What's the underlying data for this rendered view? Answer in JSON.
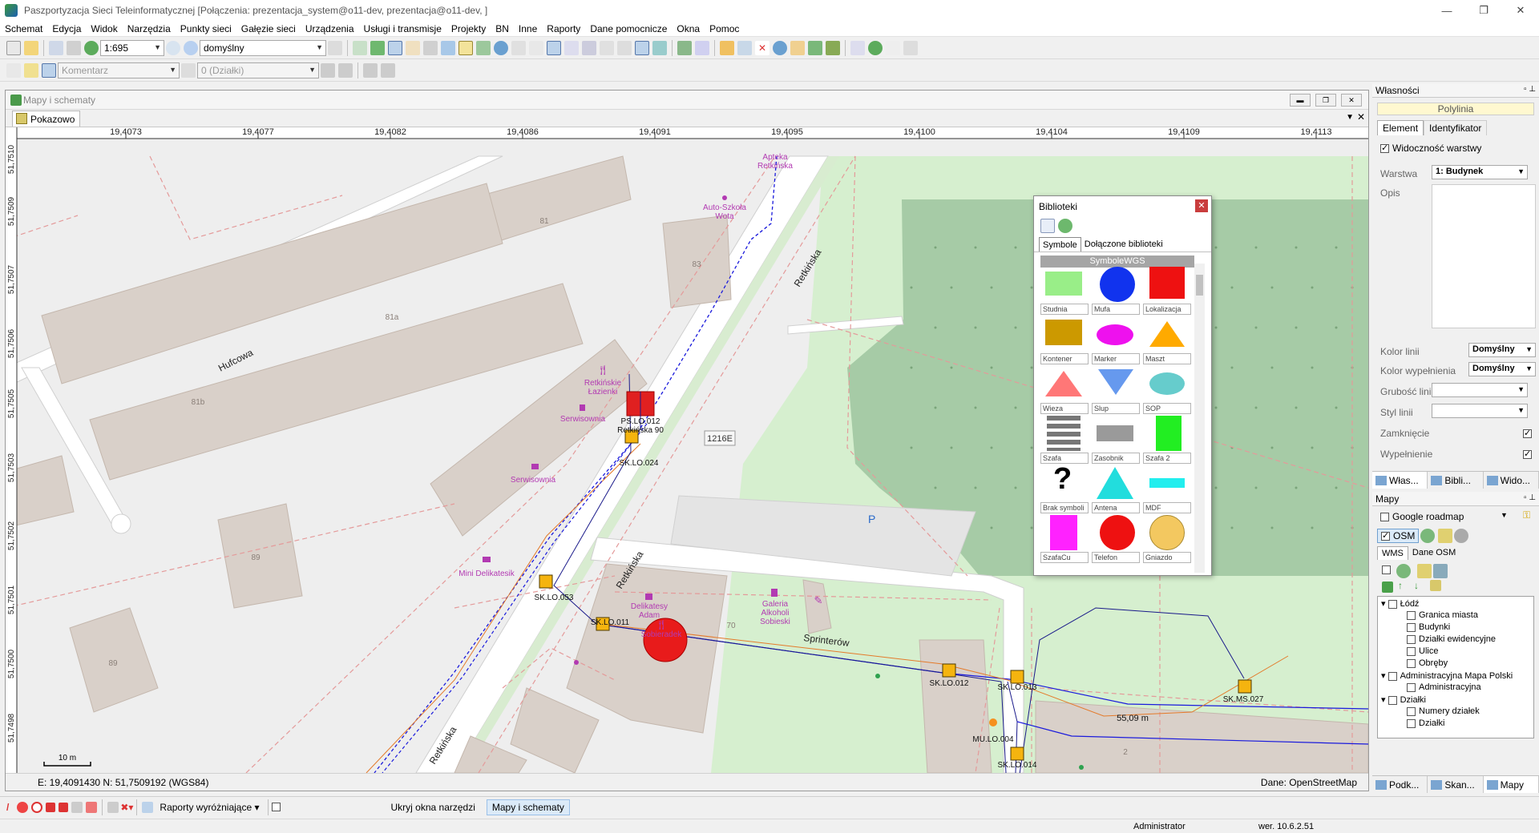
{
  "window": {
    "title": "Paszportyzacja Sieci Teleinformatycznej [Połączenia: prezentacja_system@o11-dev, prezentacja@o11-dev, ]"
  },
  "menu": [
    "Schemat",
    "Edycja",
    "Widok",
    "Narzędzia",
    "Punkty sieci",
    "Gałęzie sieci",
    "Urządzenia",
    "Usługi i transmisje",
    "Projekty",
    "BN",
    "Inne",
    "Raporty",
    "Dane pomocnicze",
    "Okna",
    "Pomoc"
  ],
  "toolbar1": {
    "scale": "1:695",
    "style": "domyślny"
  },
  "toolbar2": {
    "comment": "Komentarz",
    "parcels": "0 (Działki)"
  },
  "mapwindow": {
    "title": "Mapy i schematy",
    "tab": "Pokazowo",
    "status_coords": "E: 19,4091430  N: 51,7509192 (WGS84)",
    "status_source": "Dane: OpenStreetMap",
    "x_ticks": [
      "19,4073",
      "19,4077",
      "19,4082",
      "19,4086",
      "19,4091",
      "19,4095",
      "19,4100",
      "19,4104",
      "19,4109",
      "19,4113"
    ],
    "y_ticks": [
      "51,7510",
      "51,7509",
      "51,7507",
      "51,7506",
      "51,7505",
      "51,7503",
      "51,7502",
      "51,7501",
      "51,7500",
      "51,7498"
    ],
    "map_labels": {
      "street1": "Hufcowa",
      "street2": "Retkińska",
      "street3": "Retkińska",
      "street4": "Retkińska",
      "street5": "Sprinterów",
      "road_badge": "1216E",
      "b81": "81",
      "b81a": "81a",
      "b81b": "81b",
      "b83": "83",
      "b89a": "89",
      "b89b": "89",
      "b70": "70",
      "b2": "2",
      "poi1": "Apteka",
      "poi1b": "Retkińska",
      "poi2": "Auto-Szkoła",
      "poi2b": "Wota",
      "poi3": "Retkińskie",
      "poi3b": "Łazienki",
      "poi4": "Serwisownia",
      "poi5": "Serwisownia",
      "poi6": "Mini Delikatesik",
      "poi7": "Delikatesy",
      "poi7b": "Adam",
      "poi8": "Sobieradek",
      "poi9": "Galeria",
      "poi9b": "Alkoholi",
      "poi9c": "Sobieski",
      "parking": "P",
      "node_ps": "PS.LO.012",
      "node_ps_addr": "Retkińska 90",
      "n1": "SK.LO.024",
      "n2": "SK.LO.053",
      "n3": "SK.LO.011",
      "n4": "SK.LO.012",
      "n5": "SK.LO.013",
      "n6": "SK.LO.014",
      "n7": "SK.MS.027",
      "n8": "MU.LO.004",
      "distance": "55,09 m",
      "scalebar": "10 m"
    }
  },
  "biblioteki": {
    "title": "Biblioteki",
    "tabs": [
      "Symbole",
      "Dołączone biblioteki"
    ],
    "header": "SymboleWGS",
    "symbols": [
      "Studnia",
      "Mufa",
      "Lokalizacja",
      "Kontener",
      "Marker",
      "Maszt",
      "Wieza",
      "Slup",
      "SOP",
      "Szafa",
      "Zasobnik",
      "Szafa 2",
      "Brak symboli",
      "Antena",
      "MDF",
      "SzafaCu",
      "Telefon",
      "Gniazdo"
    ],
    "colors": {
      "studnia": "#99ee88",
      "mufa": "#1133ee",
      "lokalizacja": "#ee1111",
      "kontener": "#cc9900",
      "marker": "#ee11ee",
      "maszt": "#ffaa00",
      "wieza": "#ff7777",
      "slup": "#6699ee",
      "sop": "#66cccc",
      "szafa2": "#22ee22",
      "antena": "#22dddd",
      "mdf": "#22eeee",
      "szafacu": "#ff22ff",
      "telefon": "#ee1111",
      "gniazdo": "#f3c860"
    }
  },
  "properties": {
    "title": "Własności",
    "object": "Polylinia",
    "tabs": [
      "Element",
      "Identyfikator"
    ],
    "visibility": "Widoczność warstwy",
    "layer_label": "Warstwa",
    "layer_value": "1: Budynek",
    "desc_label": "Opis",
    "line_color_label": "Kolor linii",
    "line_color_value": "Domyślny",
    "fill_color_label": "Kolor wypełnienia",
    "fill_color_value": "Domyślny",
    "line_width_label": "Grubość linii",
    "line_style_label": "Styl linii",
    "closed_label": "Zamknięcie",
    "fill_label": "Wypełnienie",
    "bottom_tabs": [
      "Włas...",
      "Bibli...",
      "Wido..."
    ]
  },
  "maps": {
    "title": "Mapy",
    "google": "Google roadmap",
    "osm": "OSM",
    "tabs": [
      "WMS",
      "Dane OSM"
    ],
    "tree": [
      "Łódź",
      "Granica miasta",
      "Budynki",
      "Działki ewidencyjne",
      "Ulice",
      "Obręby",
      "Administracyjna Mapa Polski",
      "Administracyjna",
      "Działki",
      "Numery działek",
      "Działki"
    ],
    "bottom_tabs": [
      "Podk...",
      "Skan...",
      "Mapy"
    ]
  },
  "bottombar": {
    "reports": "Raporty wyróżniające",
    "hide": "Ukryj okna narzędzi",
    "maps": "Mapy i schematy"
  },
  "status": {
    "user": "Administrator",
    "version": "wer. 10.6.2.51"
  }
}
